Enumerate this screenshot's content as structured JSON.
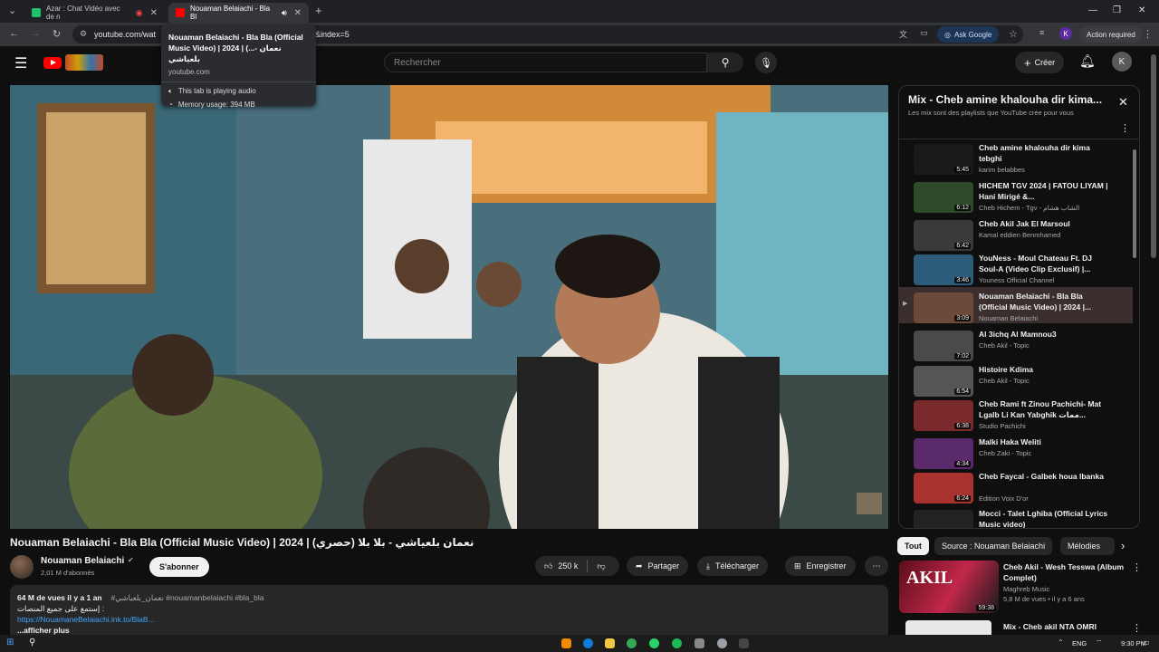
{
  "browser": {
    "tabs": [
      {
        "title": "Azar : Chat Vidéo avec de n",
        "active": false
      },
      {
        "title": "Nouaman Belaiachi - Bla Bl",
        "active": true
      }
    ],
    "url": "youtube.com/wat",
    "url_tail": "&index=5",
    "ask_google": "Ask Google",
    "action_required": "Action required",
    "profile_initial": "K"
  },
  "tab_tooltip": {
    "title": "Nouaman Belaiachi - Bla Bla (Official Music Video) | 2024 | (...- نعمان بلعياشي",
    "domain": "youtube.com",
    "audio": "This tab is playing audio",
    "memory": "Memory usage: 394 MB"
  },
  "youtube": {
    "search_placeholder": "Rechercher",
    "create_label": "Créer",
    "avatar_initial": "K"
  },
  "video": {
    "title": "Nouaman Belaiachi - Bla Bla (Official Music Video) | 2024 | (حصري) نعمان بلعياشي - بلا بلا",
    "channel": "Nouaman Belaiachi",
    "subscribers": "2,01 M d'abonnés",
    "subscribe": "S'abonner",
    "likes": "250 k",
    "share": "Partager",
    "download": "Télécharger",
    "save": "Enregistrer",
    "views_date": "64 M de vues  il y a 1 an",
    "tags": "#نعمان_بلعياشي #nouamanbelaiachi #bla_bla",
    "line2": "إستمع على جميع المنصات :",
    "link": "https://NouamaneBelaiachi.lnk.to/BlaB...",
    "more": "...afficher plus"
  },
  "playlist": {
    "title": "Mix - Cheb amine khalouha dir kima...",
    "subtitle": "Les mix sont des playlists que YouTube crée pour vous",
    "items": [
      {
        "title": "Cheb amine khalouha dir kima tebghi",
        "channel": "karim belabbes",
        "duration": "5:45"
      },
      {
        "title": "HICHEM TGV 2024 | FATOU LIYAM | Hani Mirigé &...",
        "channel": "Cheb Hichem - Tgv - الشاب هشام",
        "duration": "6:12"
      },
      {
        "title": "Cheb Akil Jak El Marsoul",
        "channel": "Kamal eddien Benmhamed",
        "duration": "6:42"
      },
      {
        "title": "YouNess - Moul Chateau Ft. DJ Soul-A (Video Clip Exclusif) |...",
        "channel": "Youness Official Channel",
        "duration": "3:46"
      },
      {
        "title": "Nouaman Belaiachi - Bla Bla (Official Music Video) | 2024 |...",
        "channel": "Nouaman Belaiachi",
        "duration": "3:09"
      },
      {
        "title": "Al 3ichq Al Mamnou3",
        "channel": "Cheb Akil - Topic",
        "duration": "7:02"
      },
      {
        "title": "Histoire Kdima",
        "channel": "Cheb Akil - Topic",
        "duration": "6:54"
      },
      {
        "title": "Cheb Rami ft Zinou Pachichi- Mat Lgalb Li Kan Yabghik ممات...",
        "channel": "Studio Pachichi",
        "duration": "6:38"
      },
      {
        "title": "Malki Haka Weliti",
        "channel": "Cheb Zaki - Topic",
        "duration": "4:34"
      },
      {
        "title": "Cheb Faycal - Galbek houa lbanka",
        "channel": "Edition Voix D'or",
        "duration": "6:24"
      },
      {
        "title": "Mocci - Talet Lghiba (Official Lyrics Music video)",
        "channel": "",
        "duration": ""
      }
    ]
  },
  "chips": [
    "Tout",
    "Source : Nouaman Belaiachi",
    "Mélodies"
  ],
  "recommended": [
    {
      "title": "Cheb Akil - Wesh Tesswa (Album Complet)",
      "channel": "Maghreb Music",
      "meta": "5,8 M de vues • il y a 6 ans",
      "duration": "59:38"
    },
    {
      "title": "Mix - Cheb akil  NTA OMRI",
      "channel": "",
      "meta": "",
      "duration": ""
    }
  ],
  "taskbar": {
    "lang": "ENG",
    "time": "9:30 PM"
  }
}
